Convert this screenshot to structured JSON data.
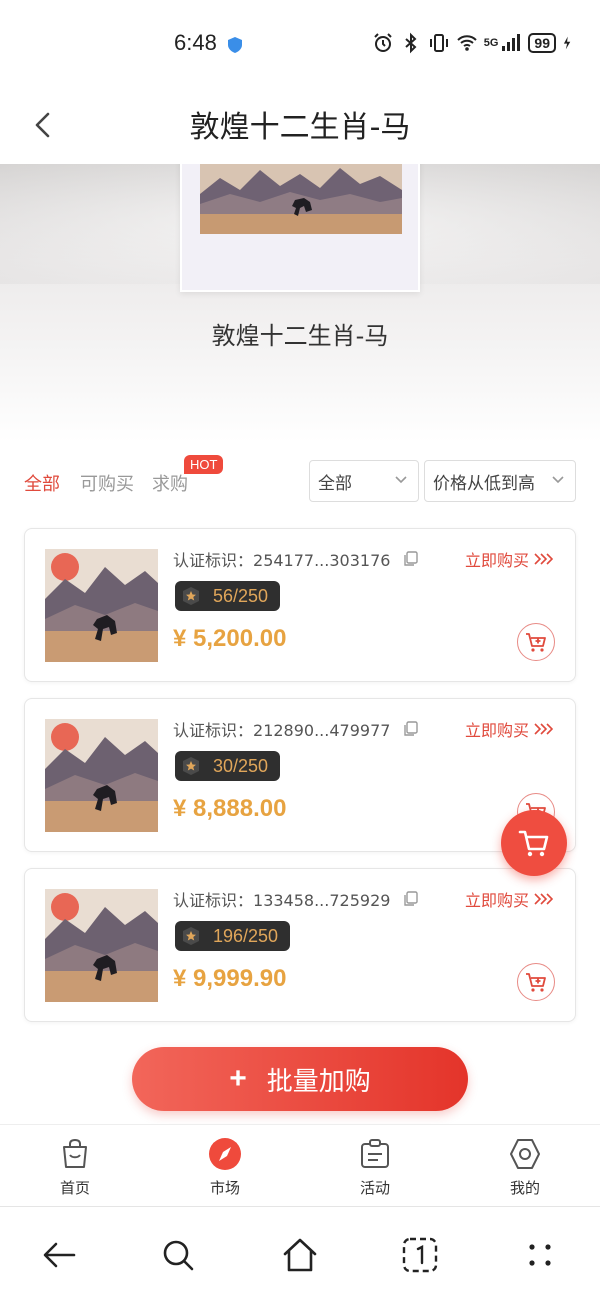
{
  "status_bar": {
    "time": "6:48",
    "network": "5G",
    "battery": "99"
  },
  "header": {
    "title": "敦煌十二生肖-马"
  },
  "hero": {
    "name": "敦煌十二生肖-马"
  },
  "filter": {
    "tabs": [
      {
        "label": "全部",
        "active": true
      },
      {
        "label": "可购买",
        "active": false
      },
      {
        "label": "求购",
        "active": false
      }
    ],
    "hot_badge": "HOT",
    "dropdown_category": "全部",
    "dropdown_sort": "价格从低到高"
  },
  "items": [
    {
      "cert_label": "认证标识：",
      "cert_id": "254177...303176",
      "buy_label": "立即购买",
      "edition": "56/250",
      "price": "¥ 5,200.00"
    },
    {
      "cert_label": "认证标识：",
      "cert_id": "212890...479977",
      "buy_label": "立即购买",
      "edition": "30/250",
      "price": "¥ 8,888.00"
    },
    {
      "cert_label": "认证标识：",
      "cert_id": "133458...725929",
      "buy_label": "立即购买",
      "edition": "196/250",
      "price": "¥ 9,999.90"
    }
  ],
  "bulk_buy": {
    "plus": "+",
    "label": "批量加购"
  },
  "bottom_nav": [
    {
      "label": "首页",
      "icon": "bag-icon"
    },
    {
      "label": "市场",
      "icon": "compass-icon",
      "active": true
    },
    {
      "label": "活动",
      "icon": "clipboard-icon"
    },
    {
      "label": "我的",
      "icon": "hexagon-icon"
    }
  ],
  "colors": {
    "accent": "#e04a3c",
    "price": "#e7a341",
    "edition_text": "#e0a65a",
    "edition_bg": "#2f2f2f"
  }
}
